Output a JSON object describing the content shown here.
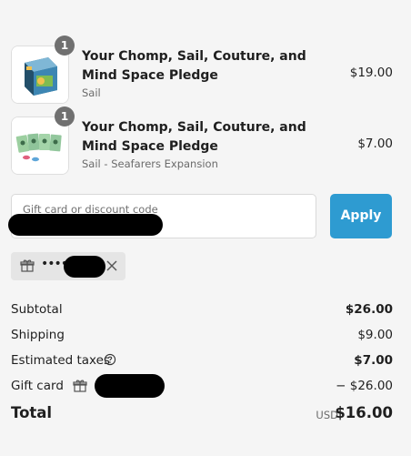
{
  "line_items": [
    {
      "title": "Your Chomp, Sail, Couture, and Mind Space Pledge",
      "variant": "Sail",
      "price": "$19.00",
      "quantity": "1",
      "image": "board-game-box"
    },
    {
      "title": "Your Chomp, Sail, Couture, and Mind Space Pledge",
      "variant": "Sail - Seafarers Expansion",
      "price": "$7.00",
      "quantity": "1",
      "image": "expansion-cards"
    }
  ],
  "discount": {
    "placeholder": "Gift card or discount code",
    "apply_label": "Apply",
    "applied_code_masked": "••••"
  },
  "summary": {
    "subtotal_label": "Subtotal",
    "subtotal_value": "$26.00",
    "shipping_label": "Shipping",
    "shipping_value": "$9.00",
    "taxes_label": "Estimated taxes",
    "taxes_value": "$7.00",
    "gift_card_label": "Gift card",
    "gift_card_value": "− $26.00",
    "total_label": "Total",
    "currency": "USD",
    "total_value": "$16.00"
  },
  "colors": {
    "accent": "#2e9bd1",
    "background": "#f5f5f5",
    "badge": "#707070"
  }
}
